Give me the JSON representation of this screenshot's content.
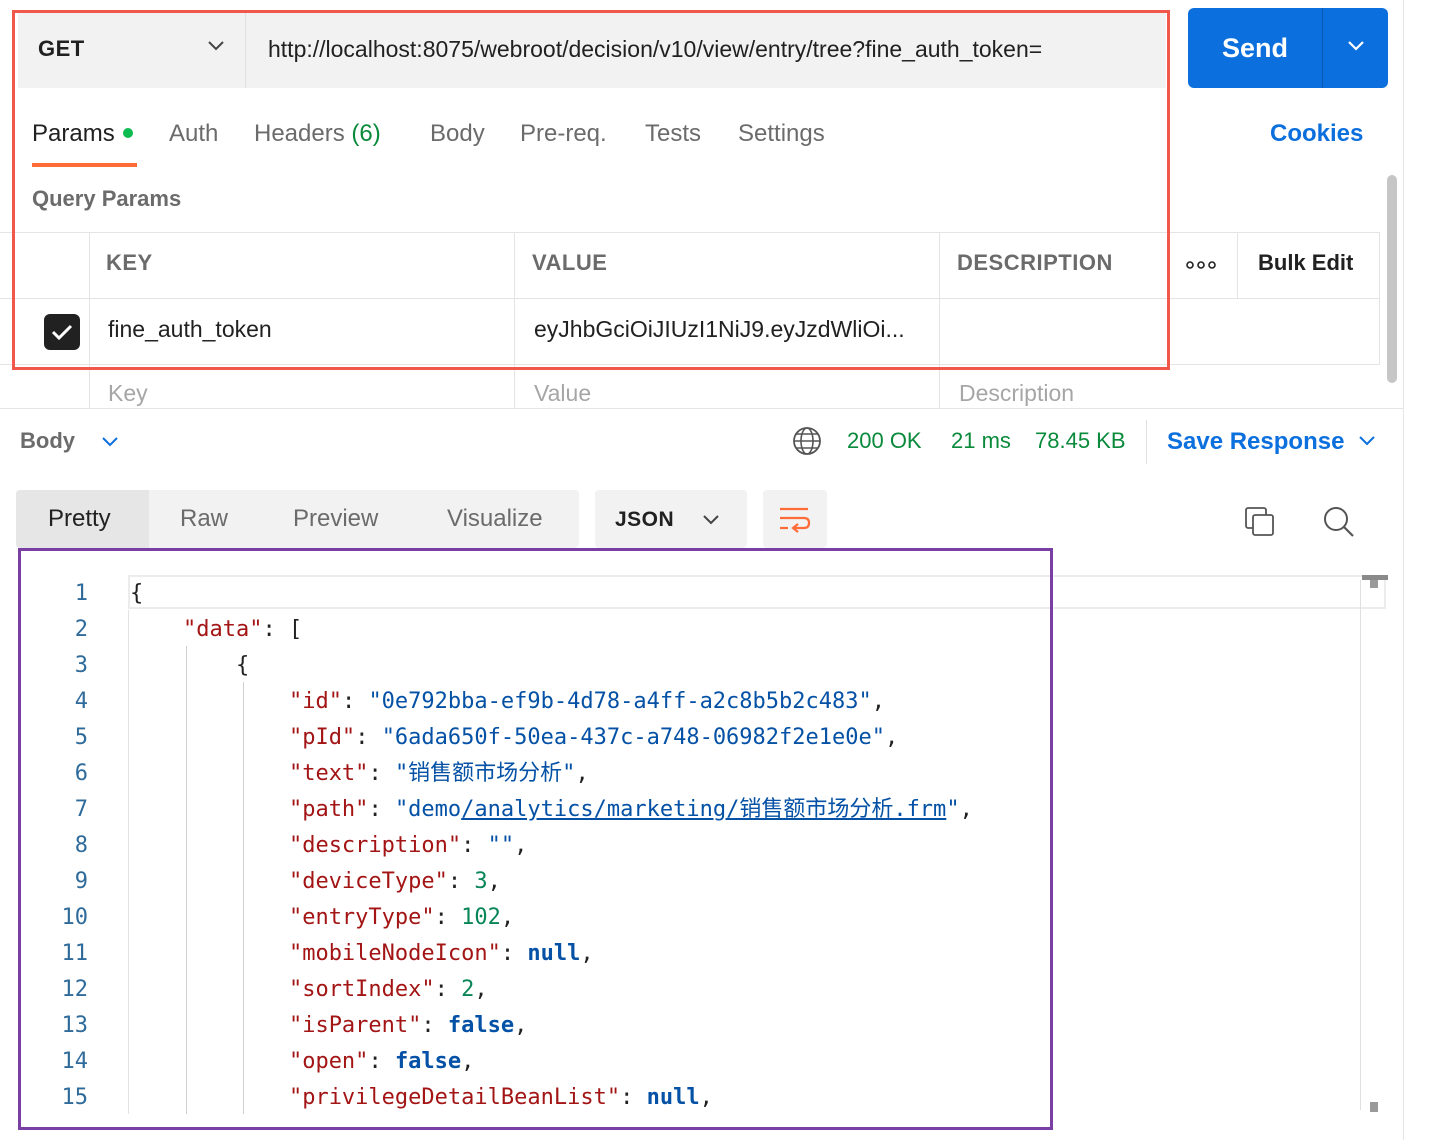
{
  "request": {
    "method": "GET",
    "url": "http://localhost:8075/webroot/decision/v10/view/entry/tree?fine_auth_token=",
    "send_label": "Send"
  },
  "tabs": {
    "params": "Params",
    "auth": "Auth",
    "headers": "Headers",
    "headers_count": "(6)",
    "body": "Body",
    "prereq": "Pre-req.",
    "tests": "Tests",
    "settings": "Settings",
    "cookies": "Cookies"
  },
  "query_params": {
    "title": "Query Params",
    "columns": [
      "KEY",
      "VALUE",
      "DESCRIPTION"
    ],
    "bulk_edit": "Bulk Edit",
    "rows": [
      {
        "checked": true,
        "key": "fine_auth_token",
        "value": "eyJhbGciOiJIUzI1NiJ9.eyJzdWliOi...",
        "description": ""
      }
    ],
    "placeholders": {
      "key": "Key",
      "value": "Value",
      "description": "Description"
    }
  },
  "response": {
    "body_label": "Body",
    "status": "200 OK",
    "time": "21 ms",
    "size": "78.45 KB",
    "save_label": "Save Response",
    "view_tabs": [
      "Pretty",
      "Raw",
      "Preview",
      "Visualize"
    ],
    "format": "JSON",
    "line_numbers": [
      "1",
      "2",
      "3",
      "4",
      "5",
      "6",
      "7",
      "8",
      "9",
      "10",
      "11",
      "12",
      "13",
      "14",
      "15"
    ],
    "json": {
      "key_data": "\"data\"",
      "key_id": "\"id\"",
      "val_id": "\"0e792bba-ef9b-4d78-a4ff-a2c8b5b2c483\"",
      "key_pid": "\"pId\"",
      "val_pid": "\"6ada650f-50ea-437c-a748-06982f2e1e0e\"",
      "key_text": "\"text\"",
      "val_text": "\"销售额市场分析\"",
      "key_path": "\"path\"",
      "val_path_prefix": "\"demo",
      "val_path_link": "/analytics/marketing/销售额市场分析.frm",
      "val_path_suffix": "\"",
      "key_description": "\"description\"",
      "val_description": "\"\"",
      "key_deviceType": "\"deviceType\"",
      "val_deviceType": "3",
      "key_entryType": "\"entryType\"",
      "val_entryType": "102",
      "key_mobileNodeIcon": "\"mobileNodeIcon\"",
      "val_mobileNodeIcon": "null",
      "key_sortIndex": "\"sortIndex\"",
      "val_sortIndex": "2",
      "key_isParent": "\"isParent\"",
      "val_isParent": "false",
      "key_open": "\"open\"",
      "val_open": "false",
      "key_privilege": "\"privilegeDetailBeanList\"",
      "val_privilege": "null"
    }
  },
  "colors": {
    "accent": "#0c6fde",
    "brand_orange": "#ff6c37",
    "success_green": "#0a8a3b",
    "highlight_red": "#f2574c",
    "highlight_purple": "#7a3fa5"
  }
}
